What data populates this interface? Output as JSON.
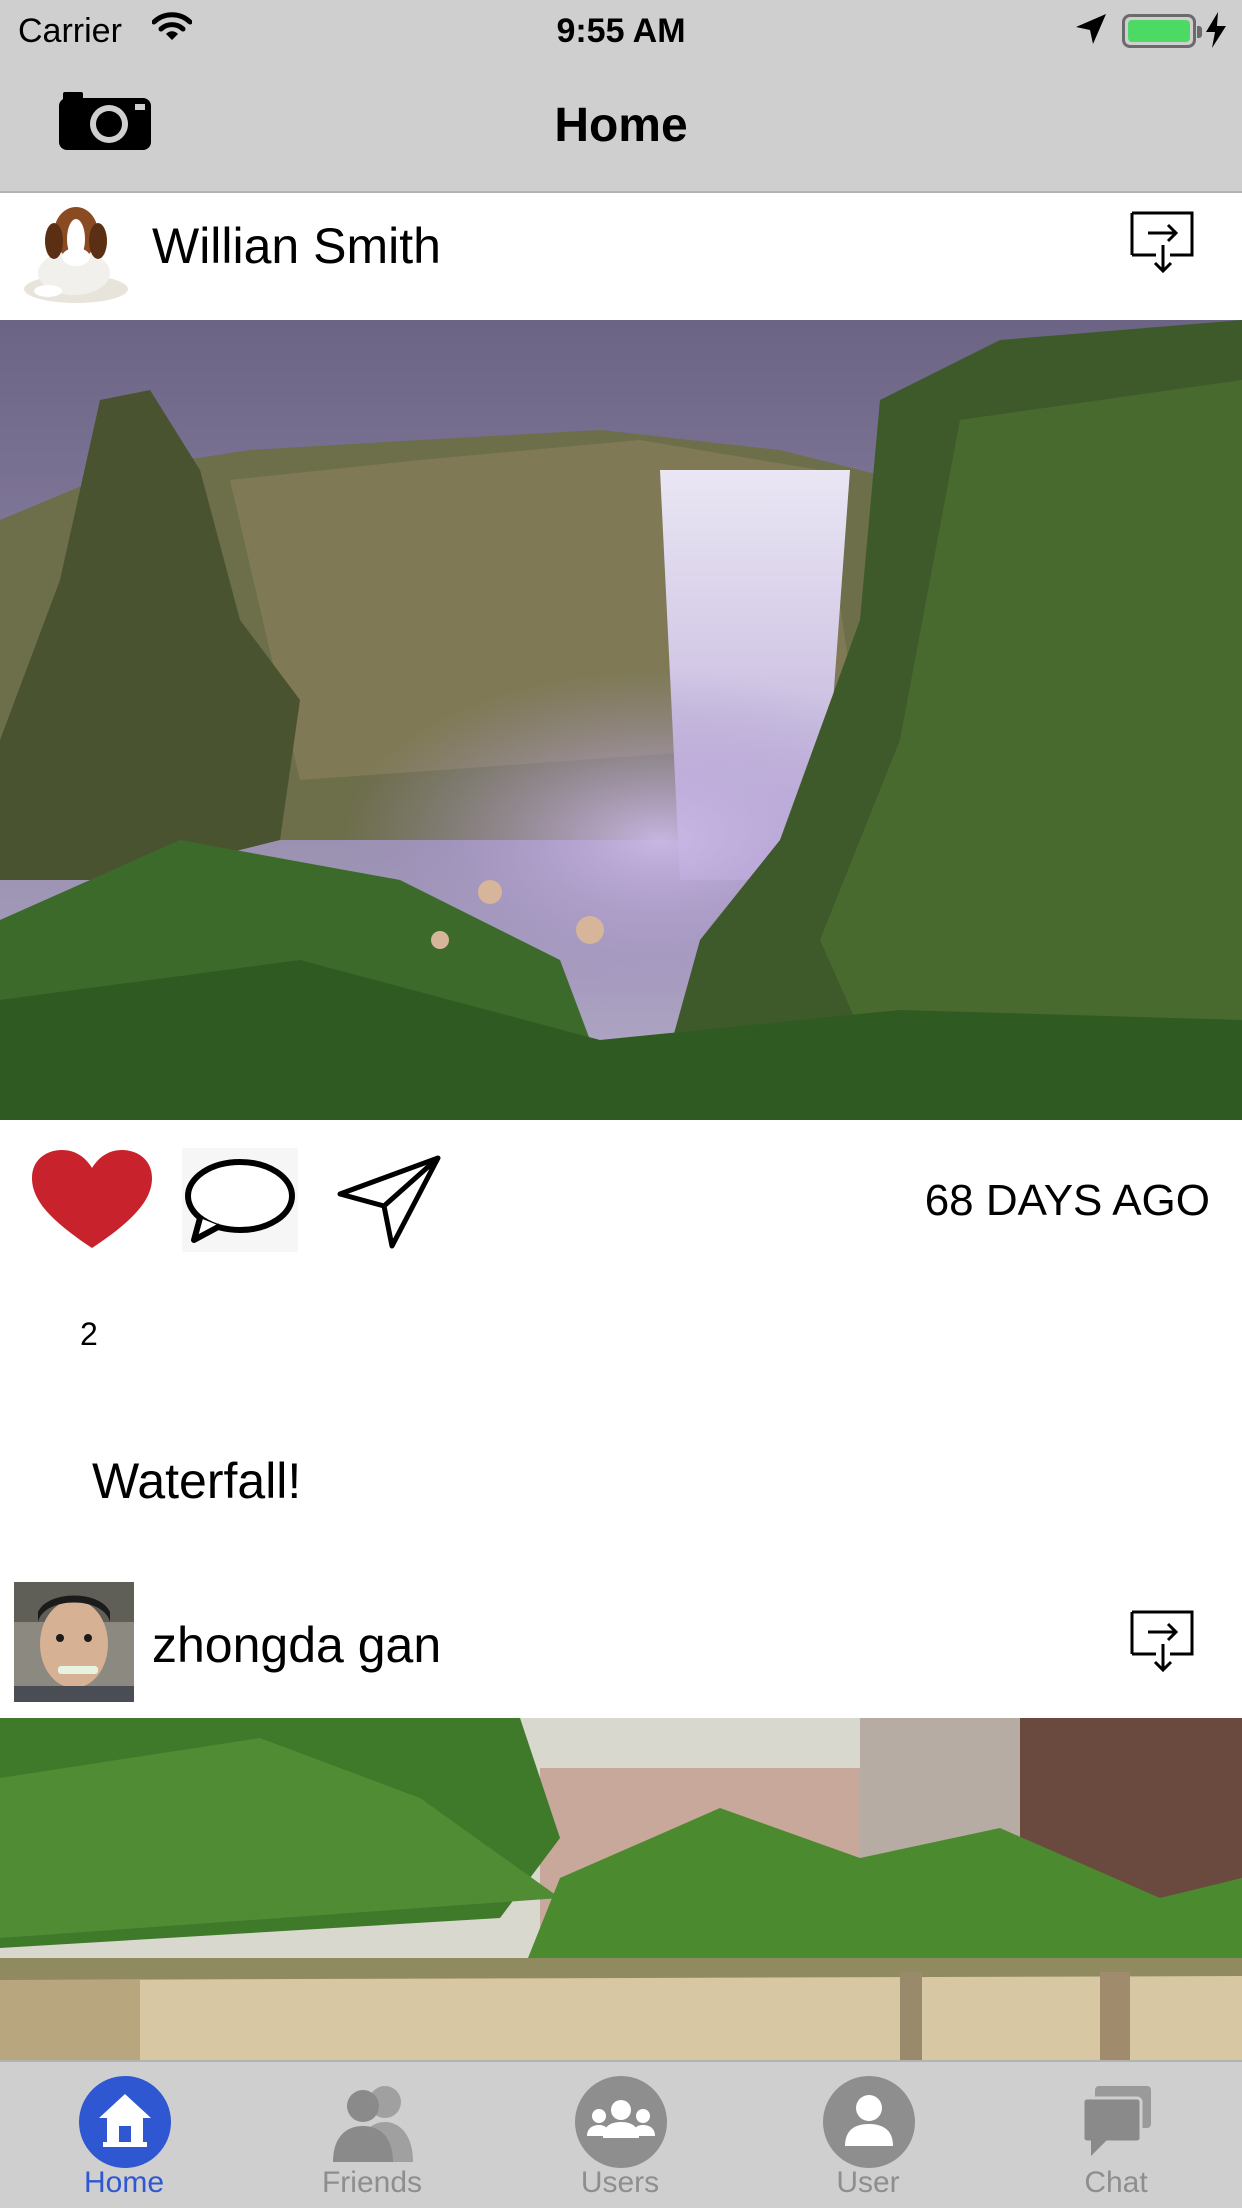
{
  "status_bar": {
    "carrier": "Carrier",
    "time": "9:55 AM"
  },
  "nav": {
    "title": "Home",
    "left_icon": "camera-icon"
  },
  "feed": {
    "posts": [
      {
        "username": "Willian Smith",
        "avatar": "dog-avatar",
        "photo": "waterfall-photo",
        "time_ago": "68 DAYS AGO",
        "likes": "2",
        "caption": "Waterfall!"
      },
      {
        "username": "zhongda gan",
        "avatar": "person-avatar",
        "photo": "garden-photo"
      }
    ]
  },
  "tabbar": {
    "active_color": "#2f57d1",
    "inactive_color": "#8e8e8e",
    "items": [
      {
        "label": "Home",
        "icon": "home-icon"
      },
      {
        "label": "Friends",
        "icon": "friends-icon"
      },
      {
        "label": "Users",
        "icon": "users-icon"
      },
      {
        "label": "User",
        "icon": "user-icon"
      },
      {
        "label": "Chat",
        "icon": "chat-icon"
      }
    ]
  },
  "colors": {
    "bar_bg": "#cfcfcf",
    "heart": "#c8232c",
    "battery": "#4cd964"
  }
}
